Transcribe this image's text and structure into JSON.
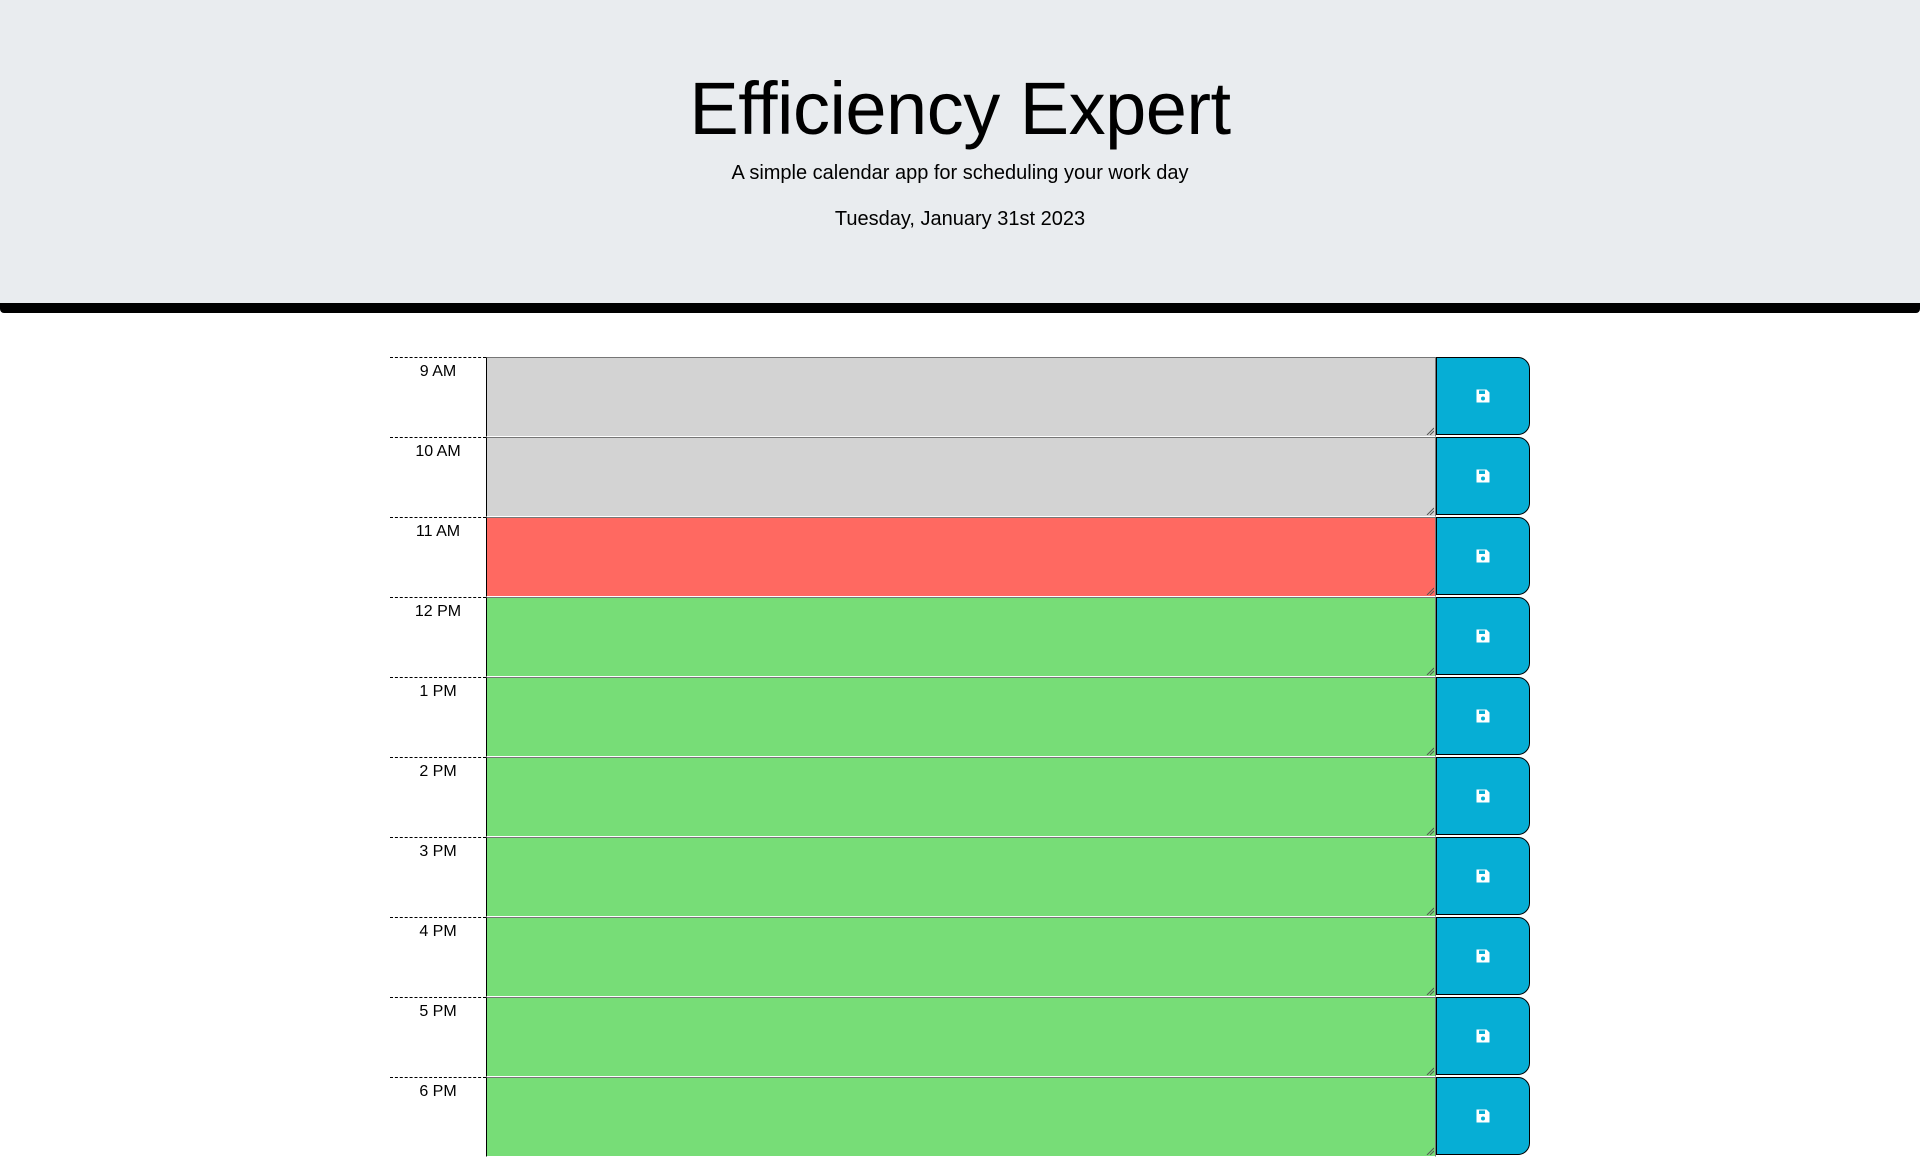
{
  "header": {
    "title": "Efficiency Expert",
    "subtitle": "A simple calendar app for scheduling your work day",
    "current_date": "Tuesday, January 31st 2023"
  },
  "hours": [
    {
      "label": "9 AM",
      "status": "past",
      "text": ""
    },
    {
      "label": "10 AM",
      "status": "past",
      "text": ""
    },
    {
      "label": "11 AM",
      "status": "present",
      "text": ""
    },
    {
      "label": "12 PM",
      "status": "future",
      "text": ""
    },
    {
      "label": "1 PM",
      "status": "future",
      "text": ""
    },
    {
      "label": "2 PM",
      "status": "future",
      "text": ""
    },
    {
      "label": "3 PM",
      "status": "future",
      "text": ""
    },
    {
      "label": "4 PM",
      "status": "future",
      "text": ""
    },
    {
      "label": "5 PM",
      "status": "future",
      "text": ""
    },
    {
      "label": "6 PM",
      "status": "future",
      "text": ""
    }
  ],
  "save_icon": "floppy-disk-icon",
  "colors": {
    "header_bg": "#e9ecef",
    "past": "#d3d3d3",
    "present": "#ff6961",
    "future": "#77dd77",
    "save_button": "#06aed5",
    "save_icon": "#ffffff"
  }
}
